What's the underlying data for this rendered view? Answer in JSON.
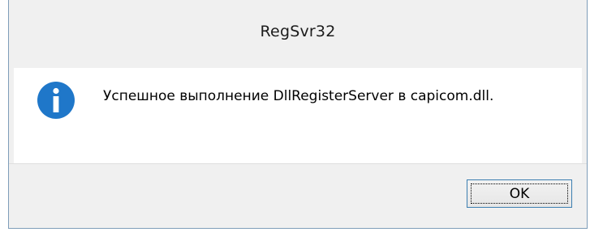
{
  "window": {
    "title": "RegSvr32"
  },
  "message": {
    "icon": "info-icon",
    "text": "Успешное выполнение DllRegisterServer в capicom.dll."
  },
  "buttons": {
    "ok_label": "OK"
  },
  "colors": {
    "icon_blue": "#1f77c9",
    "button_border": "#3c7fb1",
    "window_border": "#7f9db9"
  }
}
